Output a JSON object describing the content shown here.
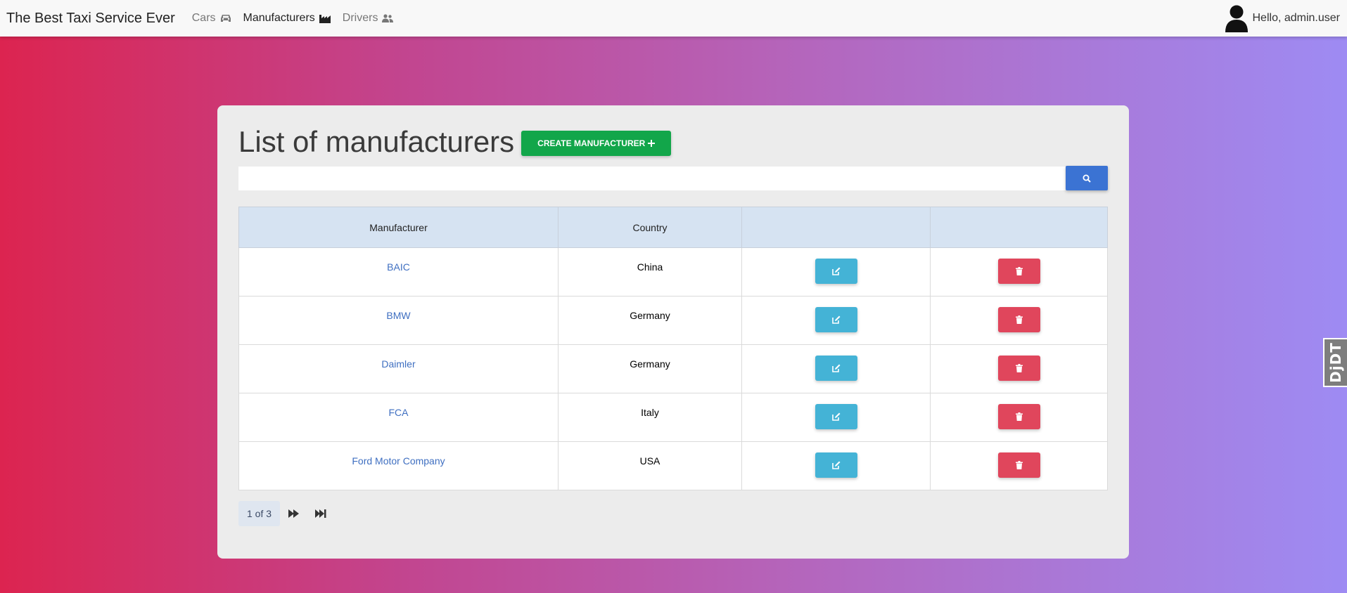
{
  "navbar": {
    "brand": "The Best Taxi Service Ever",
    "items": [
      {
        "label": "Cars",
        "icon": "car-icon"
      },
      {
        "label": "Manufacturers",
        "icon": "factory-icon"
      },
      {
        "label": "Drivers",
        "icon": "users-icon"
      }
    ],
    "active": "Manufacturers",
    "user_greeting": "Hello, admin.user"
  },
  "page": {
    "title": "List of manufacturers",
    "create_button": "CREATE MANUFACTURER",
    "search_placeholder": ""
  },
  "table": {
    "headers": [
      "Manufacturer",
      "Country",
      "",
      ""
    ],
    "rows": [
      {
        "manufacturer": "BAIC",
        "country": "China"
      },
      {
        "manufacturer": "BMW",
        "country": "Germany"
      },
      {
        "manufacturer": "Daimler",
        "country": "Germany"
      },
      {
        "manufacturer": "FCA",
        "country": "Italy"
      },
      {
        "manufacturer": "Ford Motor Company",
        "country": "USA"
      }
    ]
  },
  "pagination": {
    "label": "1 of 3"
  },
  "debug_toolbar": {
    "label": "DjDT"
  },
  "colors": {
    "create": "#12a64a",
    "search": "#3b73d3",
    "edit": "#44b3d6",
    "delete": "#e0465c"
  }
}
